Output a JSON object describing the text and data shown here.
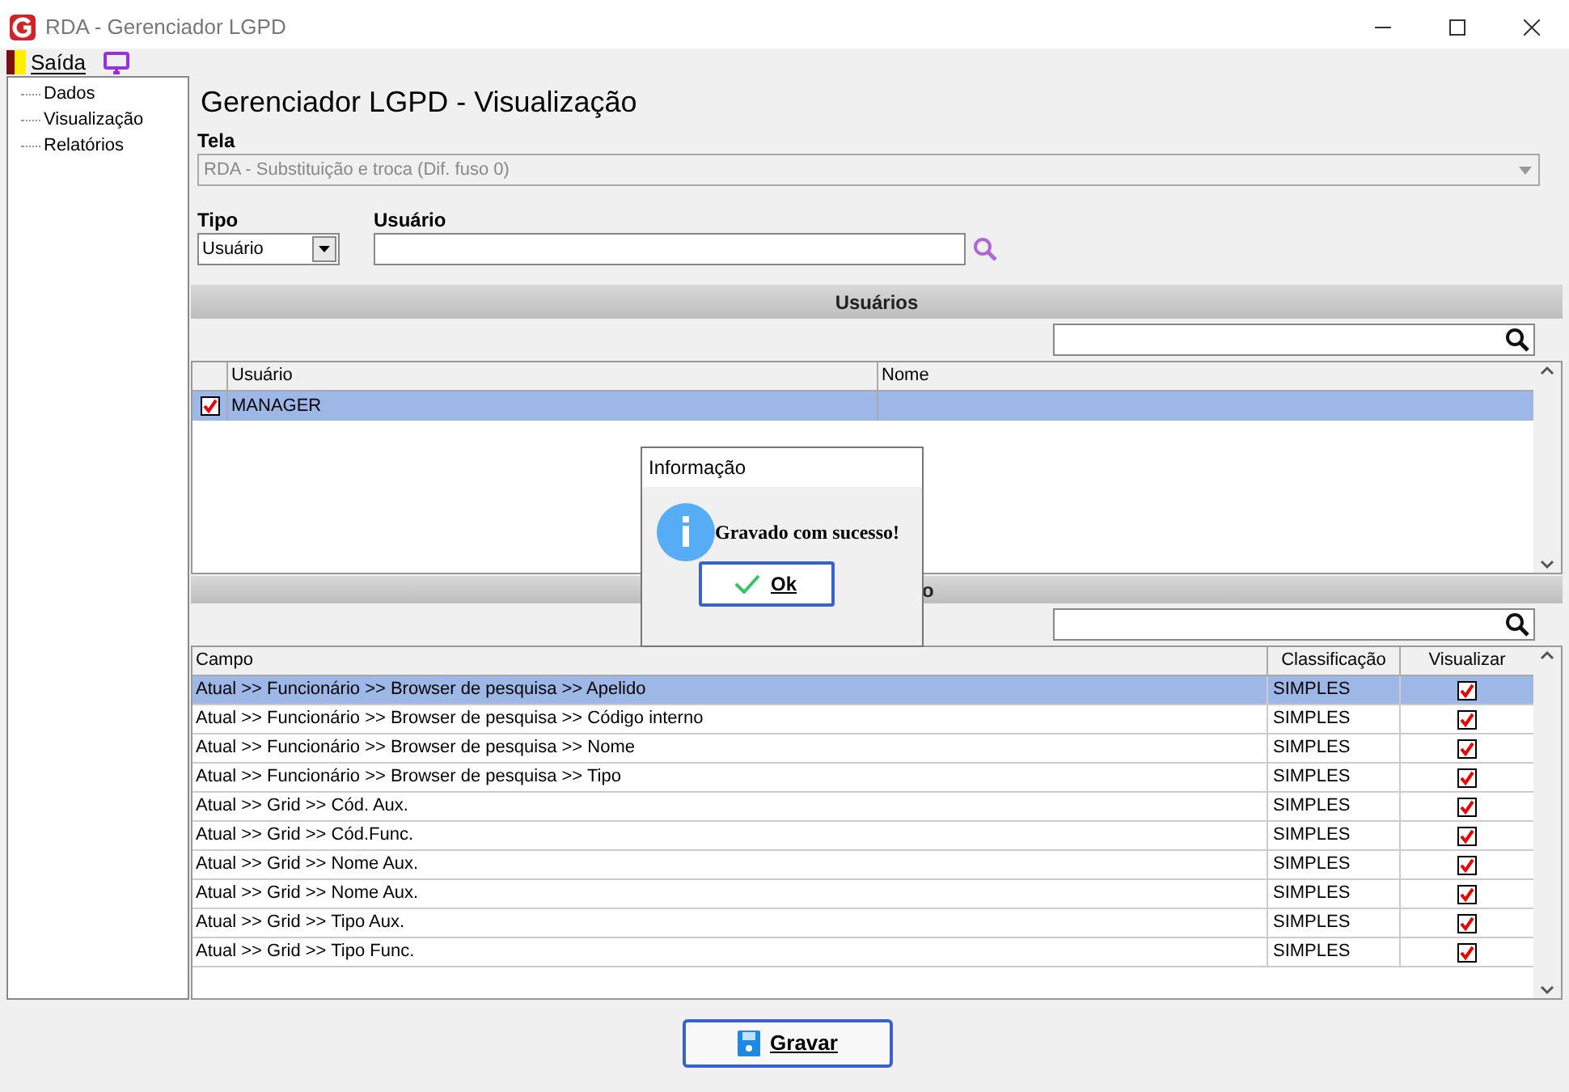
{
  "window": {
    "title": "RDA - Gerenciador LGPD"
  },
  "toolbar": {
    "exit_label": "Saída"
  },
  "sidebar": {
    "items": [
      {
        "label": "Dados"
      },
      {
        "label": "Visualização"
      },
      {
        "label": "Relatórios"
      }
    ]
  },
  "heading": "Gerenciador LGPD - Visualização",
  "tela": {
    "label": "Tela",
    "value": "RDA - Substituição e troca (Dif. fuso 0)"
  },
  "tipo": {
    "label": "Tipo",
    "value": "Usuário"
  },
  "usuario": {
    "label": "Usuário"
  },
  "users_section": {
    "title": "Usuários",
    "columns": [
      "Usuário",
      "Nome"
    ],
    "rows": [
      {
        "checked": true,
        "selected": true,
        "usuario": "MANAGER"
      }
    ]
  },
  "fields_section": {
    "title": "o",
    "columns": [
      "Campo",
      "Classificação",
      "Visualizar"
    ],
    "rows": [
      {
        "campo": "Atual >> Funcionário >> Browser de pesquisa >> Apelido",
        "classificacao": "SIMPLES",
        "visualizar": true,
        "selected": true
      },
      {
        "campo": "Atual >> Funcionário >> Browser de pesquisa >> Código interno",
        "classificacao": "SIMPLES",
        "visualizar": true,
        "selected": false
      },
      {
        "campo": "Atual >> Funcionário >> Browser de pesquisa >> Nome",
        "classificacao": "SIMPLES",
        "visualizar": true,
        "selected": false
      },
      {
        "campo": "Atual >> Funcionário >> Browser de pesquisa >> Tipo",
        "classificacao": "SIMPLES",
        "visualizar": true,
        "selected": false
      },
      {
        "campo": "Atual >> Grid >> Cód. Aux.",
        "classificacao": "SIMPLES",
        "visualizar": true,
        "selected": false
      },
      {
        "campo": "Atual >> Grid >> Cód.Func.",
        "classificacao": "SIMPLES",
        "visualizar": true,
        "selected": false
      },
      {
        "campo": "Atual >> Grid >> Nome Aux.",
        "classificacao": "SIMPLES",
        "visualizar": true,
        "selected": false
      },
      {
        "campo": "Atual >> Grid >> Nome Aux.",
        "classificacao": "SIMPLES",
        "visualizar": true,
        "selected": false
      },
      {
        "campo": "Atual >> Grid >> Tipo Aux.",
        "classificacao": "SIMPLES",
        "visualizar": true,
        "selected": false
      },
      {
        "campo": "Atual >> Grid >> Tipo Func.",
        "classificacao": "SIMPLES",
        "visualizar": true,
        "selected": false
      }
    ]
  },
  "dialog": {
    "title": "Informação",
    "message": "Gravado com sucesso!",
    "ok_label": "Ok"
  },
  "save_button": {
    "label": "Gravar"
  }
}
